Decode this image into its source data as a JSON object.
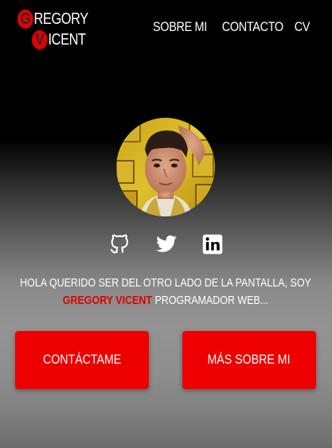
{
  "logo": {
    "line1_initial": "G",
    "line1_rest": "REGORY",
    "line2_initial": "V",
    "line2_rest": "ICENT"
  },
  "nav": {
    "items": [
      {
        "label": "SOBRE MI"
      },
      {
        "label": "CONTACTO"
      },
      {
        "label": "CV"
      }
    ]
  },
  "profile": {
    "avatar": "profile-photo"
  },
  "socials": [
    {
      "icon": "github-icon"
    },
    {
      "icon": "twitter-icon"
    },
    {
      "icon": "linkedin-icon"
    }
  ],
  "intro": {
    "text_before": "HOLA QUERIDO SER DEL OTRO LADO DE LA PANTALLA, SOY ",
    "name": "GREGORY VICENT",
    "text_after": " PROGRAMADOR WEB..."
  },
  "buttons": {
    "contact_label": "CONTÁCTAME",
    "about_label": "MÁS SOBRE MI"
  },
  "colors": {
    "accent": "#ee0000",
    "background_top": "#000000",
    "background_mid": "#939393",
    "text": "#ffffff"
  }
}
